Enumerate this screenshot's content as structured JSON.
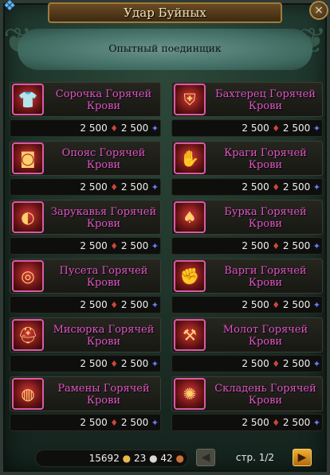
{
  "header": {
    "title": "Удар Буйных",
    "close_icon": "×"
  },
  "subtitle": "Опытный поединщик",
  "items": [
    {
      "name": "Сорочка Горячей Крови",
      "price_gold": "2 500",
      "price_crystal": "2 500",
      "icon": "shirt-icon"
    },
    {
      "name": "Бахтерец Горячей Крови",
      "price_gold": "2 500",
      "price_crystal": "2 500",
      "icon": "armor-icon"
    },
    {
      "name": "Опояс Горячей Крови",
      "price_gold": "2 500",
      "price_crystal": "2 500",
      "icon": "belt-icon"
    },
    {
      "name": "Краги Горячей Крови",
      "price_gold": "2 500",
      "price_crystal": "2 500",
      "icon": "gloves-icon"
    },
    {
      "name": "Зарукавья Горячей Крови",
      "price_gold": "2 500",
      "price_crystal": "2 500",
      "icon": "bracer-icon"
    },
    {
      "name": "Бурка Горячей Крови",
      "price_gold": "2 500",
      "price_crystal": "2 500",
      "icon": "cloak-icon"
    },
    {
      "name": "Пусета Горячей Крови",
      "price_gold": "2 500",
      "price_crystal": "2 500",
      "icon": "earring-icon"
    },
    {
      "name": "Варги Горячей Крови",
      "price_gold": "2 500",
      "price_crystal": "2 500",
      "icon": "gauntlet-icon"
    },
    {
      "name": "Мисюрка Горячей Крови",
      "price_gold": "2 500",
      "price_crystal": "2 500",
      "icon": "helmet-icon"
    },
    {
      "name": "Молот Горячей Крови",
      "price_gold": "2 500",
      "price_crystal": "2 500",
      "icon": "hammer-icon"
    },
    {
      "name": "Рамены Горячей Крови",
      "price_gold": "2 500",
      "price_crystal": "2 500",
      "icon": "shoulder-icon"
    },
    {
      "name": "Складень Горячей Крови",
      "price_gold": "2 500",
      "price_crystal": "2 500",
      "icon": "amulet-icon"
    }
  ],
  "footer": {
    "gold": "15692",
    "silver": "23",
    "copper": "42",
    "page": "стр. 1/2"
  }
}
